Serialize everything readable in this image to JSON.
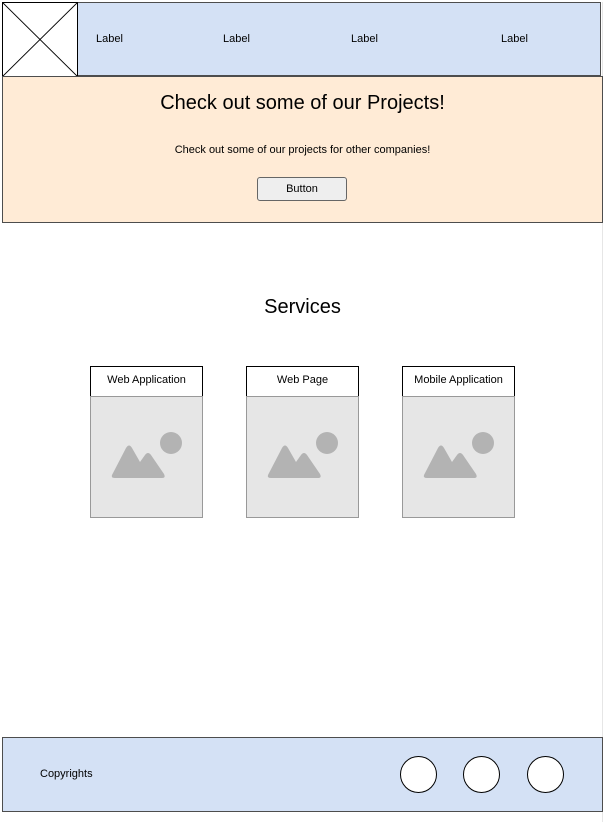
{
  "header": {
    "nav_labels": [
      "Label",
      "Label",
      "Label",
      "Label"
    ]
  },
  "hero": {
    "title": "Check out some of our Projects!",
    "subtitle": "Check out some of our projects for other companies!",
    "button_label": "Button"
  },
  "services": {
    "title": "Services",
    "cards": [
      {
        "title": "Web Application",
        "icon": "image-placeholder-icon"
      },
      {
        "title": "Web Page",
        "icon": "image-placeholder-icon"
      },
      {
        "title": "Mobile Application",
        "icon": "image-placeholder-icon"
      }
    ]
  },
  "footer": {
    "copyright": "Copyrights",
    "social_icons": [
      "social-icon-1",
      "social-icon-2",
      "social-icon-3"
    ]
  },
  "colors": {
    "header_bg": "#d4e1f5",
    "hero_bg": "#ffebd6",
    "footer_bg": "#d4e1f5",
    "image_bg": "#e6e6e6",
    "image_icon": "#b3b3b3"
  }
}
